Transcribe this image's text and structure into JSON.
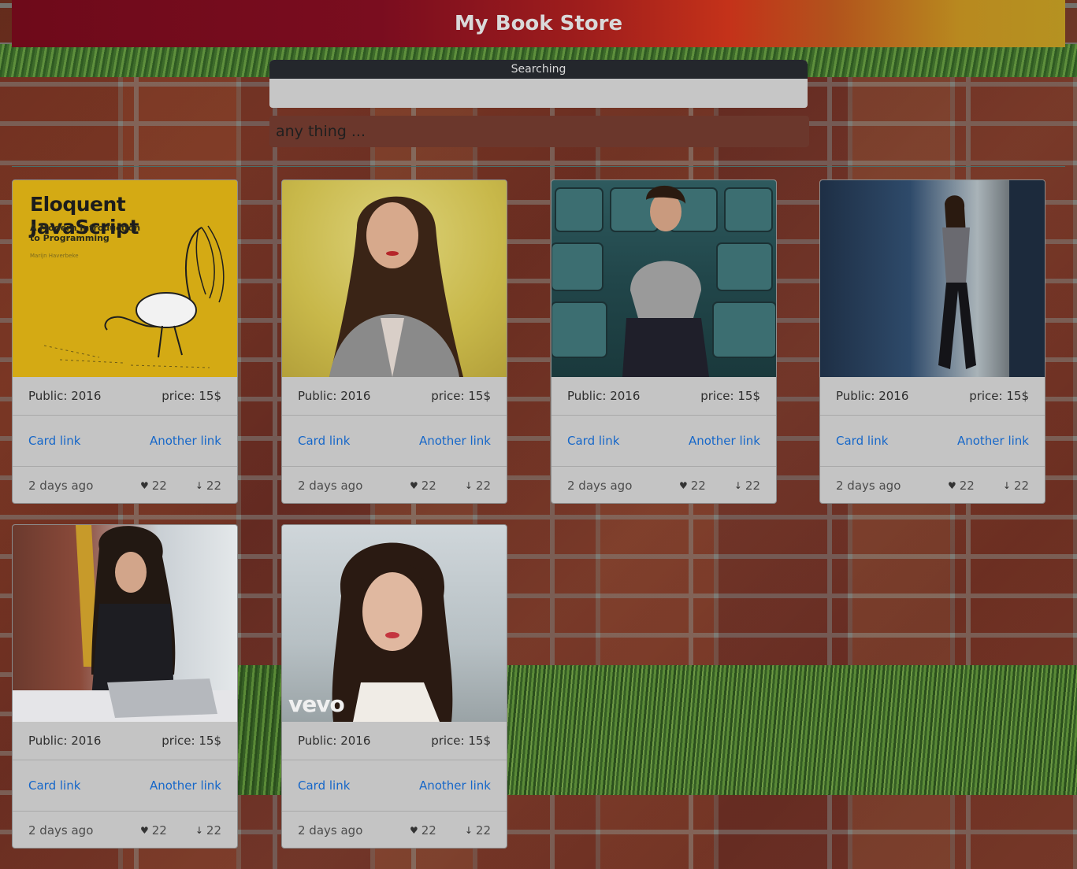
{
  "header": {
    "title": "My Book Store"
  },
  "search": {
    "label": "Searching",
    "placeholder": "any thing ..."
  },
  "cards": [
    {
      "public": "Public: 2016",
      "price": "price: 15$",
      "link1": "Card link",
      "link2": "Another link",
      "time": "2 days ago",
      "likes": "22",
      "downloads": "22",
      "image": {
        "book_title": "Eloquent JavaScript",
        "book_subtitle_1": "A Modern Introduction",
        "book_subtitle_2": "to Programming",
        "book_author": "Marijn Haverbeke"
      }
    },
    {
      "public": "Public: 2016",
      "price": "price: 15$",
      "link1": "Card link",
      "link2": "Another link",
      "time": "2 days ago",
      "likes": "22",
      "downloads": "22"
    },
    {
      "public": "Public: 2016",
      "price": "price: 15$",
      "link1": "Card link",
      "link2": "Another link",
      "time": "2 days ago",
      "likes": "22",
      "downloads": "22"
    },
    {
      "public": "Public: 2016",
      "price": "price: 15$",
      "link1": "Card link",
      "link2": "Another link",
      "time": "2 days ago",
      "likes": "22",
      "downloads": "22"
    },
    {
      "public": "Public: 2016",
      "price": "price: 15$",
      "link1": "Card link",
      "link2": "Another link",
      "time": "2 days ago",
      "likes": "22",
      "downloads": "22"
    },
    {
      "public": "Public: 2016",
      "price": "price: 15$",
      "link1": "Card link",
      "link2": "Another link",
      "time": "2 days ago",
      "likes": "22",
      "downloads": "22",
      "image": {
        "watermark": "vevo"
      }
    }
  ],
  "icons": {
    "like": "heart-icon",
    "download": "download-arrow-icon"
  }
}
